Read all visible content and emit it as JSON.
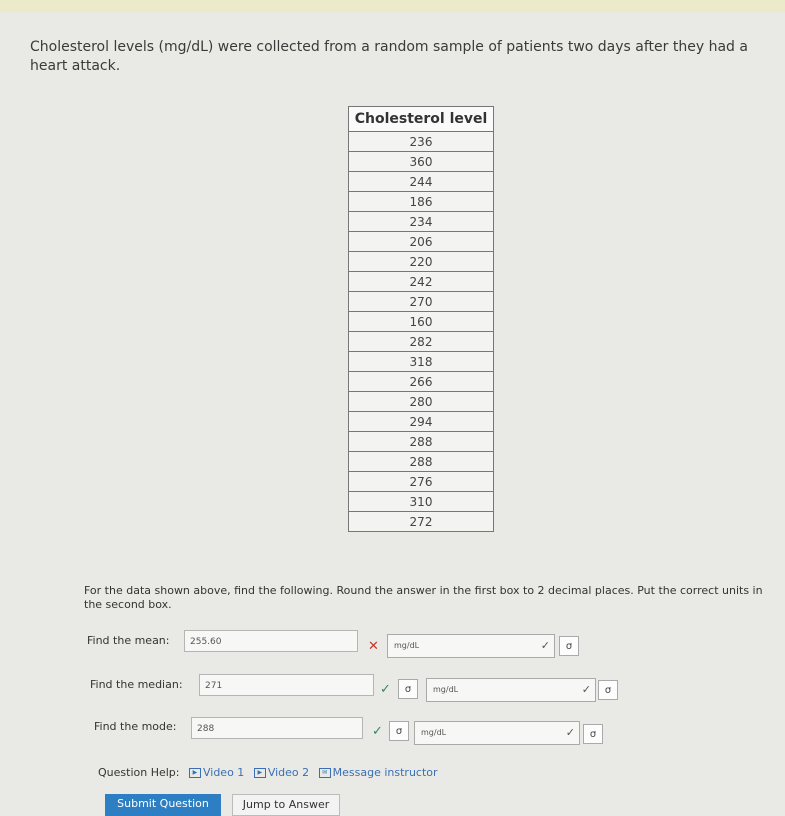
{
  "problem": {
    "text": "Cholesterol levels (mg/dL) were collected from a random sample of patients two days after they had a heart attack."
  },
  "table": {
    "header": "Cholesterol level",
    "values": [
      "236",
      "360",
      "244",
      "186",
      "234",
      "206",
      "220",
      "242",
      "270",
      "160",
      "282",
      "318",
      "266",
      "280",
      "294",
      "288",
      "288",
      "276",
      "310",
      "272"
    ]
  },
  "instructions": "For the data shown above, find the following. Round the answer in the first box to 2 decimal places. Put the correct units in the second box.",
  "questions": {
    "mean": {
      "label": "Find the mean:",
      "value": "255.60",
      "unit": "mg/dL",
      "status": "incorrect"
    },
    "median": {
      "label": "Find the median:",
      "value": "271",
      "unit": "mg/dL",
      "status": "correct"
    },
    "mode": {
      "label": "Find the mode:",
      "value": "288",
      "unit": "mg/dL",
      "status": "correct"
    }
  },
  "icons": {
    "incorrect": "x-mark",
    "correct": "check-mark",
    "sigma": "σ",
    "chevron": "chevron-down"
  },
  "help": {
    "label": "Question Help:",
    "video1": "Video 1",
    "video2": "Video 2",
    "message": "Message instructor"
  },
  "buttons": {
    "submit": "Submit Question",
    "jump": "Jump to Answer"
  },
  "colors": {
    "incorrect": "#c0392b",
    "correct": "#2e8b57",
    "primary": "#2d7ec2",
    "link": "#3b6fb3"
  }
}
